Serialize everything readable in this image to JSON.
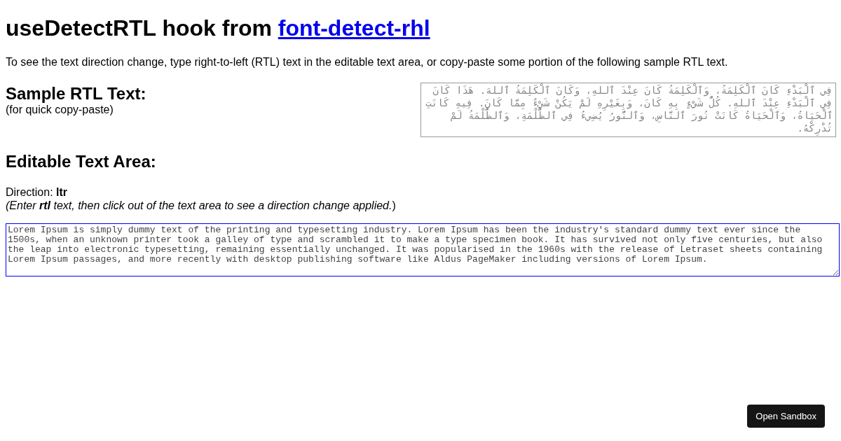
{
  "title": {
    "text": "useDetectRTL hook from ",
    "link": "font-detect-rhl"
  },
  "intro": "To see the text direction change, type right-to-left (RTL) text in the editable text area, or copy-paste some portion of the following sample RTL text.",
  "sample": {
    "heading": "Sample RTL Text:",
    "note": "(for quick copy-paste)",
    "text": "فِي ٱلْبَدْءِ كَانَ ٱلْكَلِمَةُ، وَٱلْكَلِمَةُ كَانَ عِنْدَ ٱللهِ، وَكَانَ ٱلْكَلِمَةُ ٱللهَ. هَذَا كَانَ فِي ٱلْبَدْءِ عِنْدَ ٱللهِ. كُلُّ شَيْءٍ بِهِ كَانَ، وَبِغَيْرِهِ لَمْ يَكُنْ شَيْءٌ مِمَّا كَانَ. فِيهِ كَانَتِ ٱلْحَيَاةُ، وَٱلْحَيَاةُ كَانَتْ نُورَ ٱلنَّاسِ، وَٱلنُّورُ يُضِيءُ فِي ٱلظُّلْمَةِ، وَٱلظُّلْمَةُ لَمْ تُدْرِكْهُ."
  },
  "editor": {
    "heading": "Editable Text Area:",
    "direction_label": "Direction: ",
    "direction": "ltr",
    "hint": "(Enter **rtl** text, then click out of the text area to see a direction change applied.",
    "hint_close": ")",
    "focused": true,
    "value": "Lorem Ipsum is simply dummy text of the printing and typesetting industry. Lorem Ipsum has been the industry's standard dummy text ever since the 1500s, when an unknown printer took a galley of type and scrambled it to make a type specimen book. It has survived not only five centuries, but also the leap into electronic typesetting, remaining essentially unchanged. It was popularised in the 1960s with the release of Letraset sheets containing Lorem Ipsum passages, and more recently with desktop publishing software like Aldus PageMaker including versions of Lorem Ipsum."
  },
  "sandbox_button": "Open Sandbox"
}
